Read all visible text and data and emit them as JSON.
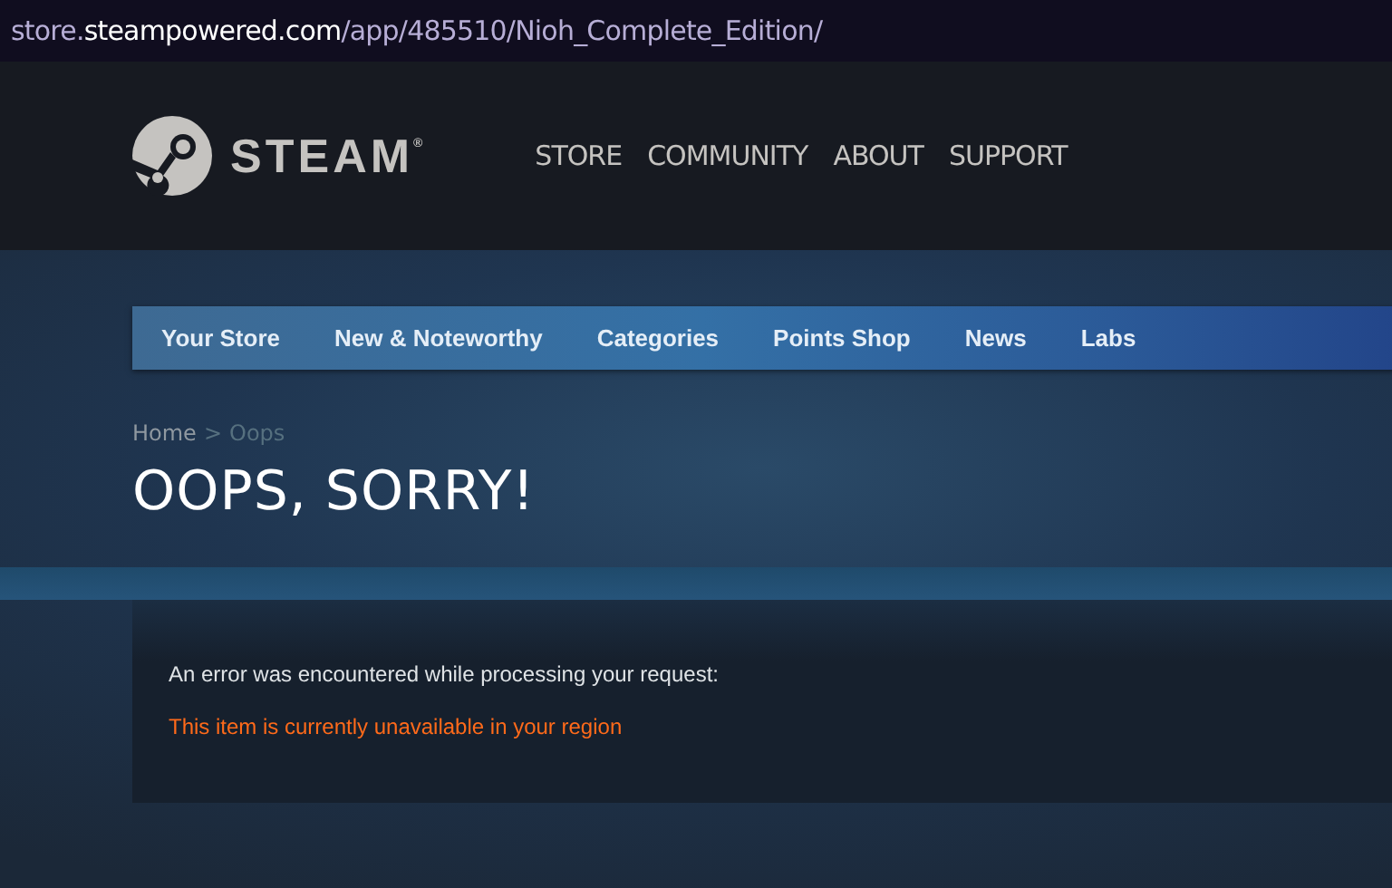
{
  "address_bar": {
    "subdomain": "store.",
    "domain": "steampowered.com",
    "path": "/app/485510/Nioh_Complete_Edition/"
  },
  "header": {
    "logo_text": "STEAM$^{®}$",
    "menu": [
      "STORE",
      "COMMUNITY",
      "ABOUT",
      "SUPPORT"
    ]
  },
  "store_nav": [
    "Your Store",
    "New & Noteworthy",
    "Categories",
    "Points Shop",
    "News",
    "Labs"
  ],
  "breadcrumbs": [
    {
      "label": "Home",
      "current": false
    },
    {
      "label": "Oops",
      "current": true
    }
  ],
  "breadcrumb_separator": ">",
  "title": "OOPS, SORRY!",
  "error": {
    "message": "An error was encountered while processing your request:",
    "detail": "This item is currently unavailable in your region"
  }
}
